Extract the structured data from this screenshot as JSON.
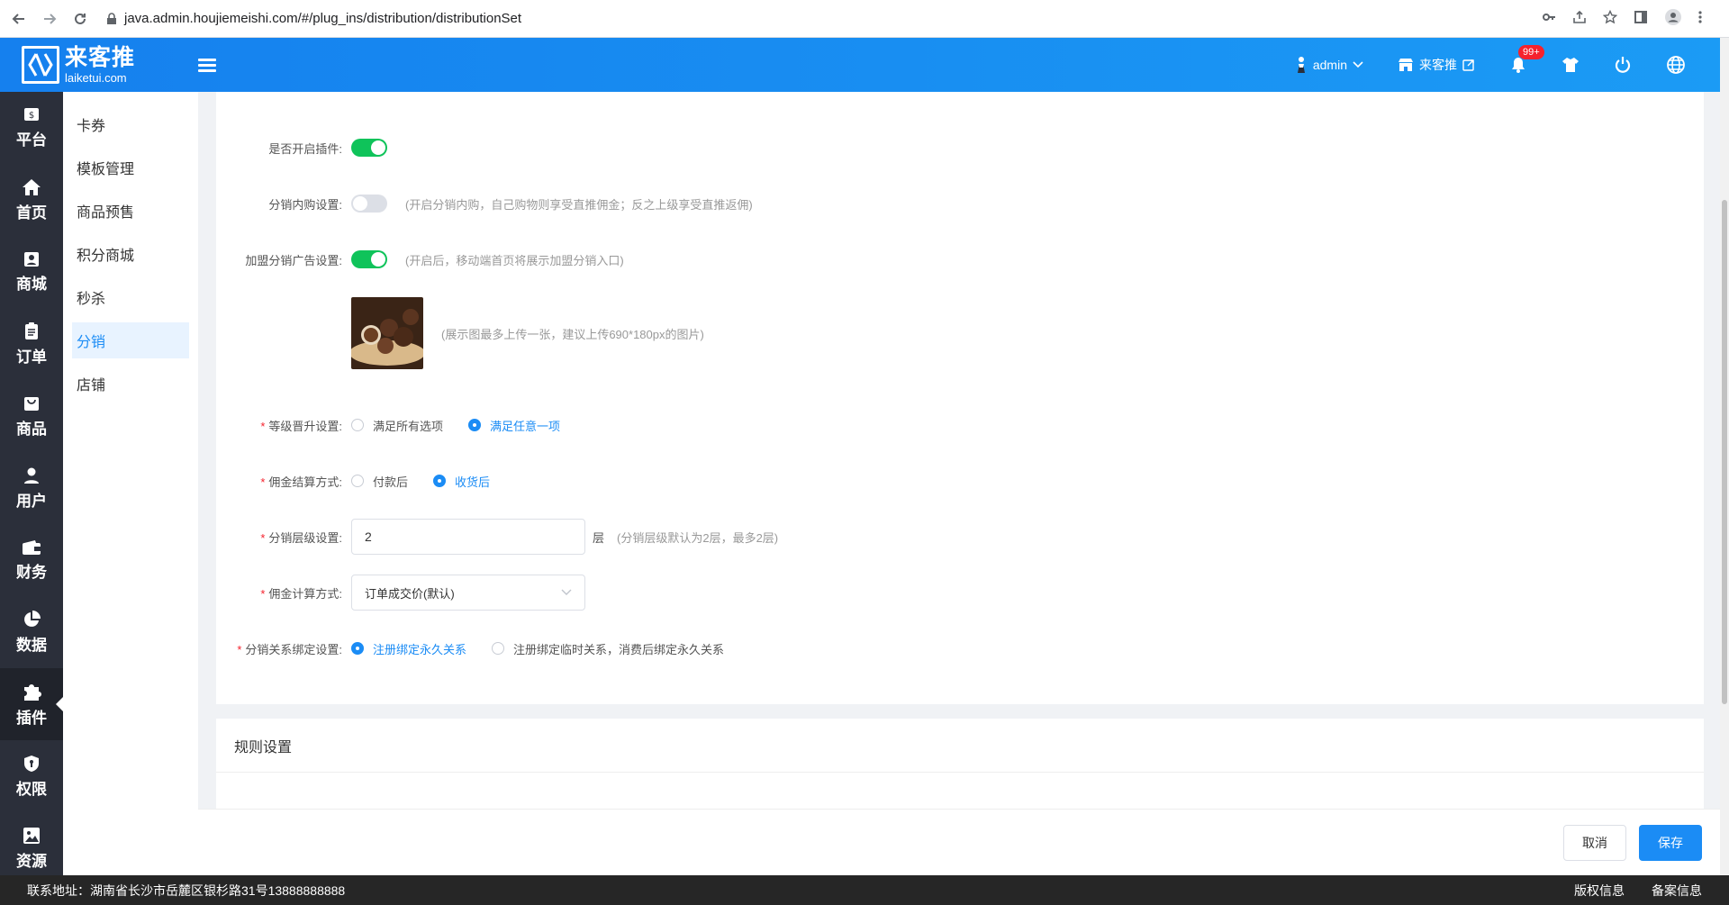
{
  "browser": {
    "url": "java.admin.houjiemeishi.com/#/plug_ins/distribution/distributionSet"
  },
  "header": {
    "logo_cn": "来客推",
    "logo_en": "laiketui.com",
    "user": "admin",
    "store": "来客推",
    "notif_badge": "99+"
  },
  "sidebar": {
    "items": [
      {
        "label": "平台",
        "icon": "dollar-icon"
      },
      {
        "label": "首页",
        "icon": "home-icon"
      },
      {
        "label": "商城",
        "icon": "store-icon"
      },
      {
        "label": "订单",
        "icon": "order-icon"
      },
      {
        "label": "商品",
        "icon": "goods-icon"
      },
      {
        "label": "用户",
        "icon": "user-icon"
      },
      {
        "label": "财务",
        "icon": "wallet-icon"
      },
      {
        "label": "数据",
        "icon": "pie-chart-icon"
      },
      {
        "label": "插件",
        "icon": "puzzle-icon",
        "active": true
      },
      {
        "label": "权限",
        "icon": "shield-icon"
      },
      {
        "label": "资源",
        "icon": "image-icon"
      }
    ]
  },
  "subnav": {
    "items": [
      "卡券",
      "模板管理",
      "商品预售",
      "积分商城",
      "秒杀",
      "分销",
      "店铺"
    ],
    "active_index": 5
  },
  "form": {
    "plugin_enable": {
      "label": "是否开启插件:",
      "on": true
    },
    "internal_buy": {
      "label": "分销内购设置:",
      "on": false,
      "hint": "(开启分销内购，自己购物则享受直推佣金；反之上级享受直推返佣)"
    },
    "join_ad": {
      "label": "加盟分销广告设置:",
      "on": true,
      "hint": "(开启后，移动端首页将展示加盟分销入口)"
    },
    "image_hint": "(展示图最多上传一张，建议上传690*180px的图片)",
    "level_upgrade": {
      "label": "等级晋升设置:",
      "options": [
        "满足所有选项",
        "满足任意一项"
      ],
      "selected": 1
    },
    "commission_settle": {
      "label": "佣金结算方式:",
      "options": [
        "付款后",
        "收货后"
      ],
      "selected": 1
    },
    "dist_levels": {
      "label": "分销层级设置:",
      "value": "2",
      "unit": "层",
      "hint": "(分销层级默认为2层，最多2层)"
    },
    "commission_calc": {
      "label": "佣金计算方式:",
      "value": "订单成交价(默认)"
    },
    "binding": {
      "label": "分销关系绑定设置:",
      "options": [
        "注册绑定永久关系",
        "注册绑定临时关系，消费后绑定永久关系"
      ],
      "selected": 0
    }
  },
  "rules": {
    "title": "规则设置"
  },
  "actions": {
    "cancel": "取消",
    "save": "保存"
  },
  "footer": {
    "address": "联系地址：湖南省长沙市岳麓区银杉路31号13888888888",
    "copyright": "版权信息",
    "record": "备案信息"
  }
}
